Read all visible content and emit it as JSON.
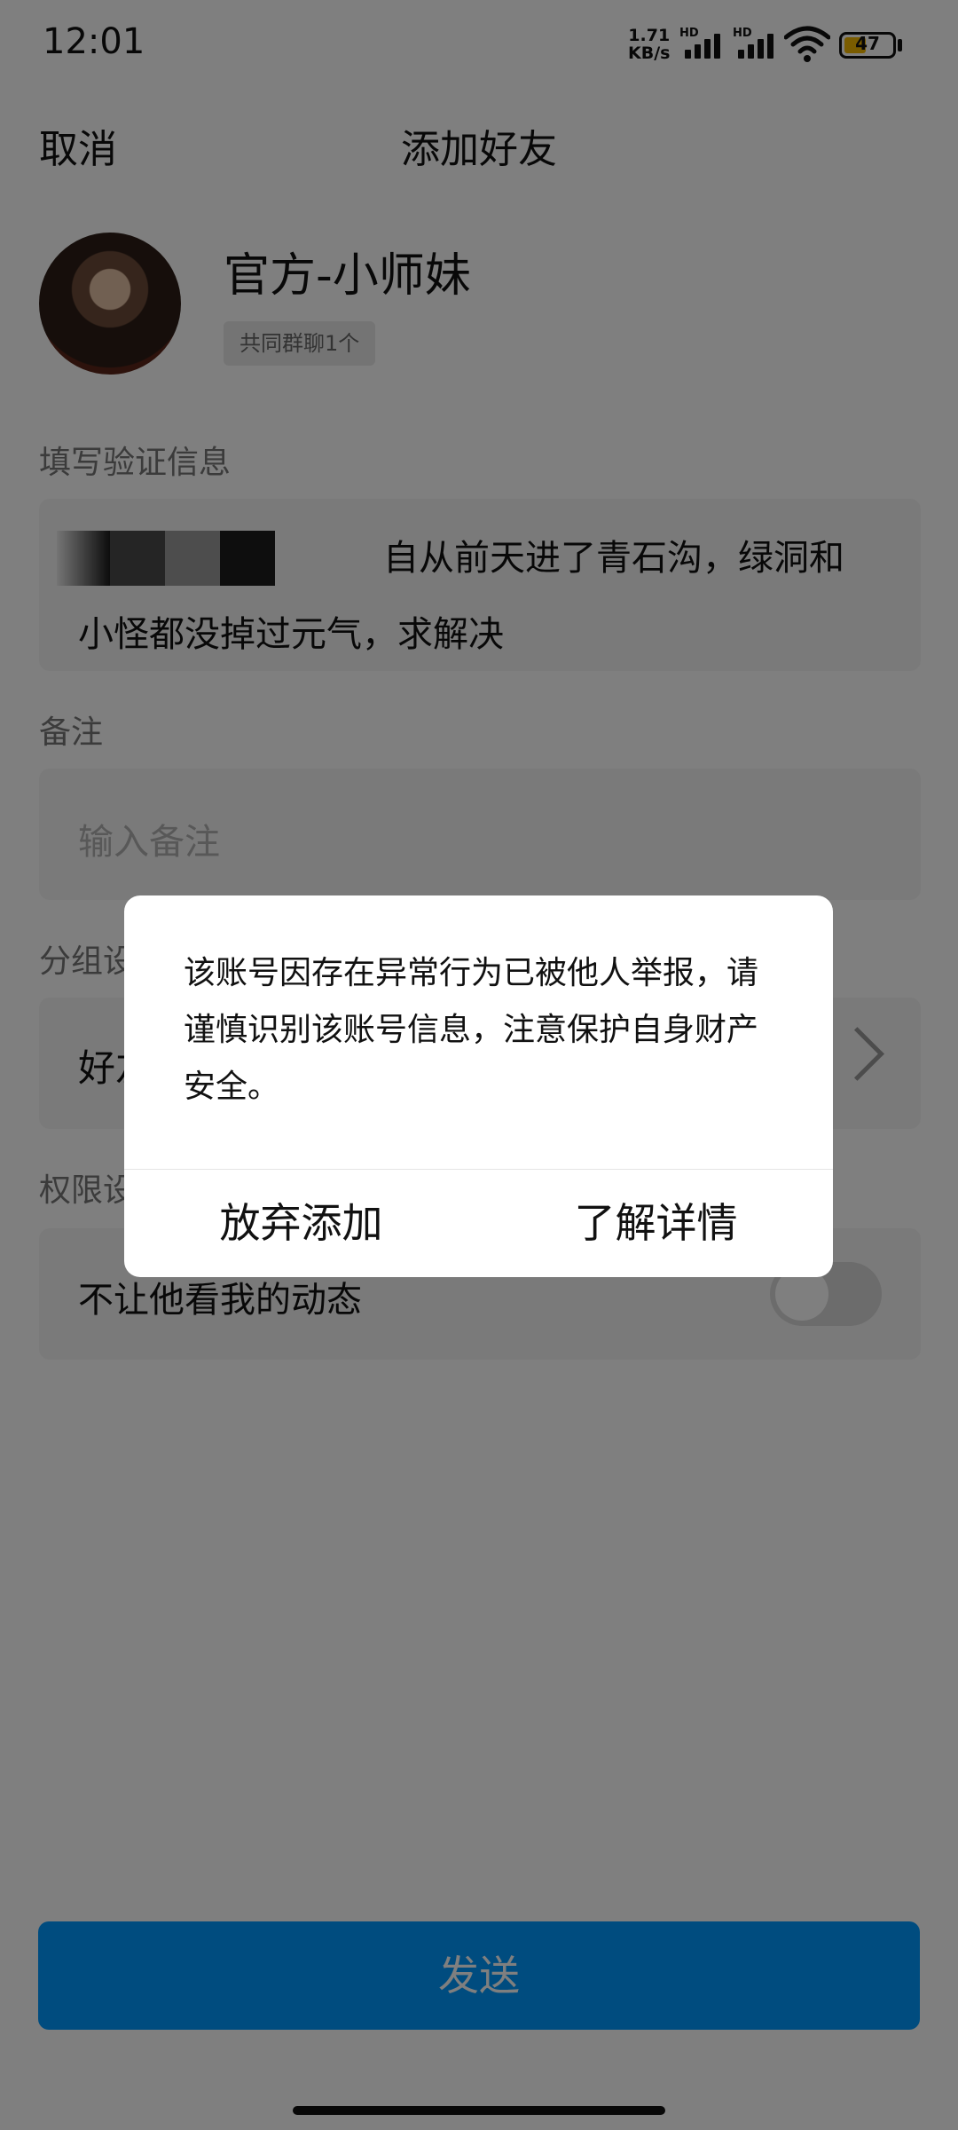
{
  "status_bar": {
    "time": "12:01",
    "net_speed_value": "1.71",
    "net_speed_unit": "KB/s",
    "sim1_label": "HD",
    "sim2_label": "HD",
    "battery": "47",
    "battery_level_percent": 47,
    "icons": [
      "signal-icon",
      "signal-icon",
      "wifi-icon",
      "battery-icon"
    ]
  },
  "header": {
    "cancel_label": "取消",
    "title": "添加好友"
  },
  "profile": {
    "nickname": "官方-小师妹",
    "common_groups": "共同群聊1个"
  },
  "verify": {
    "label": "填写验证信息",
    "text_line1": "自从前天进了青石沟，绿洞和",
    "text_line2": "小怪都没掉过元气，求解决"
  },
  "remark": {
    "label": "备注",
    "placeholder": "输入备注"
  },
  "group": {
    "label": "分组设",
    "value": "好友"
  },
  "permission": {
    "label": "权限设",
    "toggle_label": "不让他看我的动态",
    "toggle_on": false
  },
  "send_label": "发送",
  "dialog": {
    "message": "该账号因存在异常行为已被他人举报，请谨慎识别该账号信息，注意保护自身财产安全。",
    "btn_abandon": "放弃添加",
    "btn_details": "了解详情"
  },
  "colors": {
    "primary": "#0099ff",
    "overlay": "rgba(0,0,0,0.5)",
    "battery": "#f5b800"
  }
}
